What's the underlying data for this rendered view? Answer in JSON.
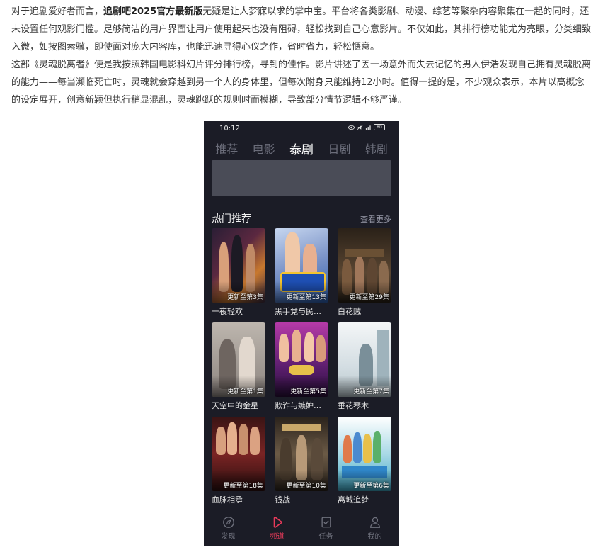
{
  "article": {
    "p1_a": "对于追剧爱好者而言，",
    "p1_bold": "追剧吧2025官方最新版",
    "p1_b": "无疑是让人梦寐以求的掌中宝。平台将各类影剧、动漫、综艺等繁杂内容聚集在一起的同时，还未设置任何观影门槛。足够简洁的用户界面让用户使用起来也没有阻碍，轻松找到自己心意影片。不仅如此，其排行榜功能尤为亮眼，分类细致入微，如按图索骥，即使面对庞大内容库，也能迅速寻得心仪之作，省时省力，轻松惬意。",
    "p2": "这部《灵魂脱离者》便是我按照韩国电影科幻片评分排行榜，寻到的佳作。影片讲述了因一场意外而失去记忆的男人伊浩发现自己拥有灵魂脱离的能力——每当濒临死亡时，灵魂就会穿越到另一个人的身体里，但每次附身只能维持12小时。值得一提的是，不少观众表示，本片以高概念的设定展开，创意新颖但执行稍显混乱，灵魂跳跃的规则时而模糊，导致部分情节逻辑不够严谨。"
  },
  "phone": {
    "status_time": "10:12",
    "battery": "80",
    "tabs": [
      {
        "label": "推荐"
      },
      {
        "label": "电影"
      },
      {
        "label": "泰剧"
      },
      {
        "label": "日剧"
      },
      {
        "label": "韩剧"
      }
    ],
    "active_tab": "泰剧",
    "section_title": "热门推荐",
    "section_more": "查看更多",
    "cards": [
      {
        "title": "一夜轻欢",
        "ep": "更新至第3集",
        "color": "#3a2a40"
      },
      {
        "title": "黑手党与民谣女",
        "ep": "更新至第13集",
        "color": "#6a7fb5"
      },
      {
        "title": "白花贼",
        "ep": "更新至第29集",
        "color": "#3b2e22"
      },
      {
        "title": "天空中的金星",
        "ep": "更新至第1集",
        "color": "#a7a3a0"
      },
      {
        "title": "欺诈与嫉妒重…",
        "ep": "更新至第5集",
        "color": "#7a2f8a"
      },
      {
        "title": "垂花琴木",
        "ep": "更新至第7集",
        "color": "#cfd8dc"
      },
      {
        "title": "血脉相承",
        "ep": "更新至第18集",
        "color": "#5a1f1f"
      },
      {
        "title": "钱战",
        "ep": "更新至第10集",
        "color": "#3f342a"
      },
      {
        "title": "离城追梦",
        "ep": "更新至第6集",
        "color": "#6fb7c9"
      }
    ],
    "nav": [
      {
        "label": "发现",
        "icon": "compass-icon"
      },
      {
        "label": "频道",
        "icon": "play-icon"
      },
      {
        "label": "任务",
        "icon": "task-icon"
      },
      {
        "label": "我的",
        "icon": "user-icon"
      }
    ],
    "accent": "#e93a5a"
  }
}
